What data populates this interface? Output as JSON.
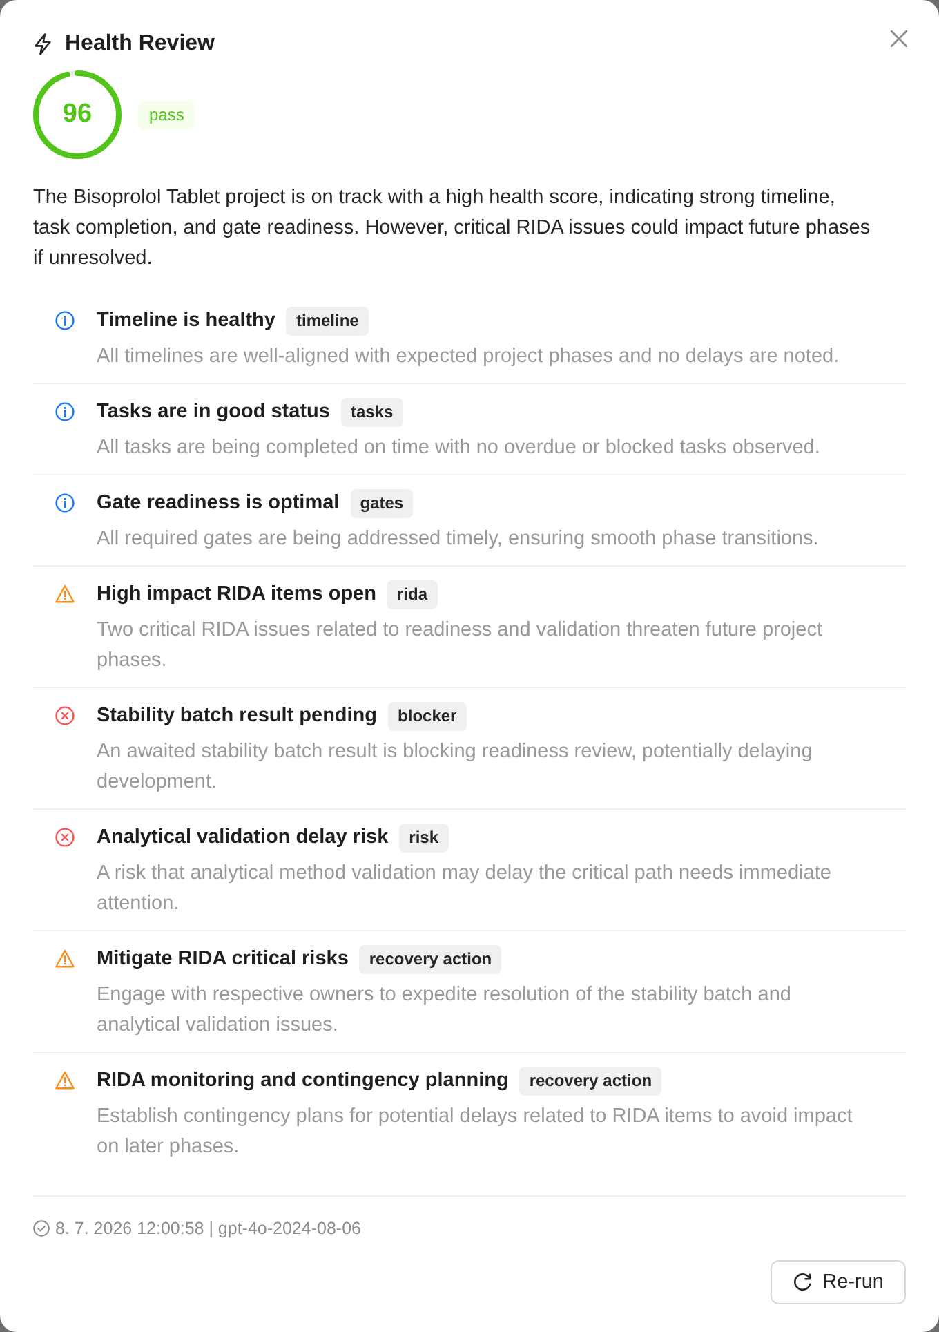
{
  "dialog": {
    "title": "Health Review",
    "score": {
      "value": "96",
      "level": 0.96,
      "badge": "pass"
    },
    "summary": "The Bisoprolol Tablet project is on track with a high health score, indicating strong timeline, task completion, and gate readiness. However, critical RIDA issues could impact future phases if unresolved.",
    "findings": [
      {
        "kind": "info",
        "title": "Timeline is healthy",
        "tag": "timeline",
        "description": "All timelines are well-aligned with expected project phases and no delays are noted."
      },
      {
        "kind": "info",
        "title": "Tasks are in good status",
        "tag": "tasks",
        "description": "All tasks are being completed on time with no overdue or blocked tasks observed."
      },
      {
        "kind": "info",
        "title": "Gate readiness is optimal",
        "tag": "gates",
        "description": "All required gates are being addressed timely, ensuring smooth phase transitions."
      },
      {
        "kind": "warning",
        "title": "High impact RIDA items open",
        "tag": "rida",
        "description": "Two critical RIDA issues related to readiness and validation threaten future project phases."
      },
      {
        "kind": "error",
        "title": "Stability batch result pending",
        "tag": "blocker",
        "description": "An awaited stability batch result is blocking readiness review, potentially delaying development."
      },
      {
        "kind": "error",
        "title": "Analytical validation delay risk",
        "tag": "risk",
        "description": "A risk that analytical method validation may delay the critical path needs immediate attention."
      },
      {
        "kind": "warning",
        "title": "Mitigate RIDA critical risks",
        "tag": "recovery action",
        "description": "Engage with respective owners to expedite resolution of the stability batch and analytical validation issues."
      },
      {
        "kind": "warning",
        "title": "RIDA monitoring and contingency planning",
        "tag": "recovery action",
        "description": "Establish contingency plans for potential delays related to RIDA items to avoid impact on later phases."
      }
    ],
    "footer": {
      "timestamp": "8. 7. 2026 12:00:58 | gpt-4o-2024-08-06"
    },
    "buttons": [
      "Re-run"
    ]
  }
}
